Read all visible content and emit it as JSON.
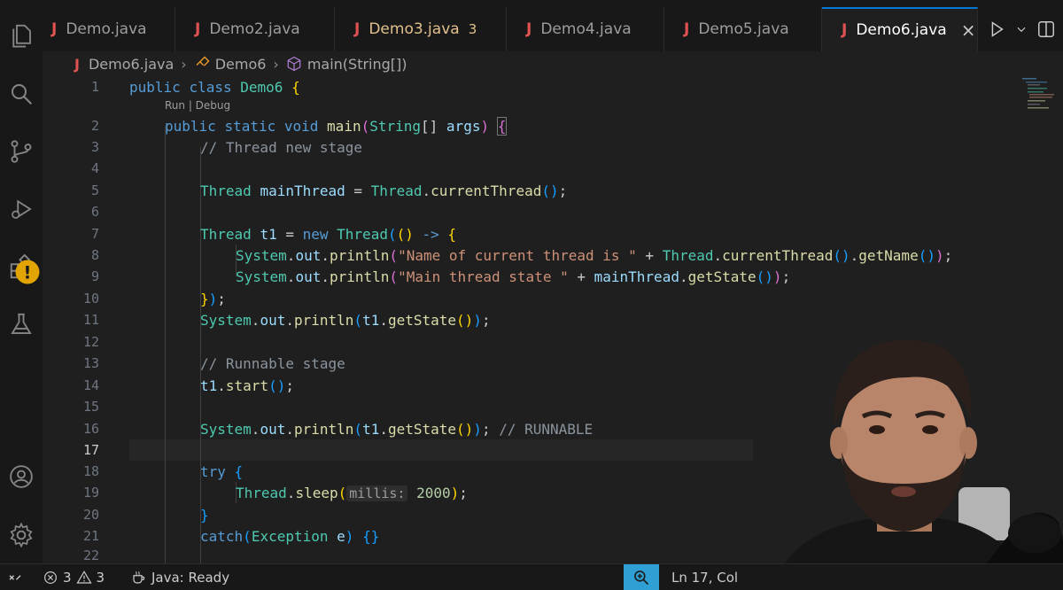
{
  "tabs": [
    {
      "label": "Demo.java",
      "icon": "java-file-icon"
    },
    {
      "label": "Demo2.java",
      "icon": "java-file-icon"
    },
    {
      "label": "Demo3.java",
      "icon": "java-file-icon",
      "problems": "3"
    },
    {
      "label": "Demo4.java",
      "icon": "java-file-icon"
    },
    {
      "label": "Demo5.java",
      "icon": "java-file-icon"
    },
    {
      "label": "Demo6.java",
      "icon": "java-file-icon",
      "active": true
    }
  ],
  "file_icon_letter": "J",
  "close_glyph": "×",
  "breadcrumb": {
    "file": "Demo6.java",
    "class": "Demo6",
    "method": "main(String[])"
  },
  "codelens": "Run | Debug",
  "lines": {
    "n1": "1",
    "n2": "2",
    "n3": "3",
    "n4": "4",
    "n5": "5",
    "n6": "6",
    "n7": "7",
    "n8": "8",
    "n9": "9",
    "n10": "10",
    "n11": "11",
    "n12": "12",
    "n13": "13",
    "n14": "14",
    "n15": "15",
    "n16": "16",
    "n17": "17",
    "n18": "18",
    "n19": "19",
    "n20": "20",
    "n21": "21",
    "n22": "22"
  },
  "code": {
    "public": "public",
    "class": "class",
    "static": "static",
    "void": "void",
    "new": "new",
    "try": "try",
    "catch": "catch",
    "Demo6": "Demo6",
    "main": "main",
    "String": "String",
    "args": "args",
    "Thread": "Thread",
    "System": "System",
    "Exception": "Exception",
    "out": "out",
    "println": "println",
    "currentThread": "currentThread",
    "getName": "getName",
    "getState": "getState",
    "start": "start",
    "sleep": "sleep",
    "mainThread": "mainThread",
    "t1": "t1",
    "e": "e",
    "comment_new": "// Thread new stage",
    "comment_runnable": "// Runnable stage",
    "comment_runnable2": "// RUNNABLE",
    "str_name": "\"Name of current thread is \"",
    "str_state": "\"Main thread state \"",
    "hint_millis": "millis:",
    "num_2000": "2000"
  },
  "status": {
    "errors": "3",
    "warnings": "3",
    "java": "Java: Ready",
    "position": "Ln 17, Col"
  },
  "colors": {
    "accent": "#0078d4",
    "java_icon": "#e05252",
    "warning": "#e2c08d"
  }
}
